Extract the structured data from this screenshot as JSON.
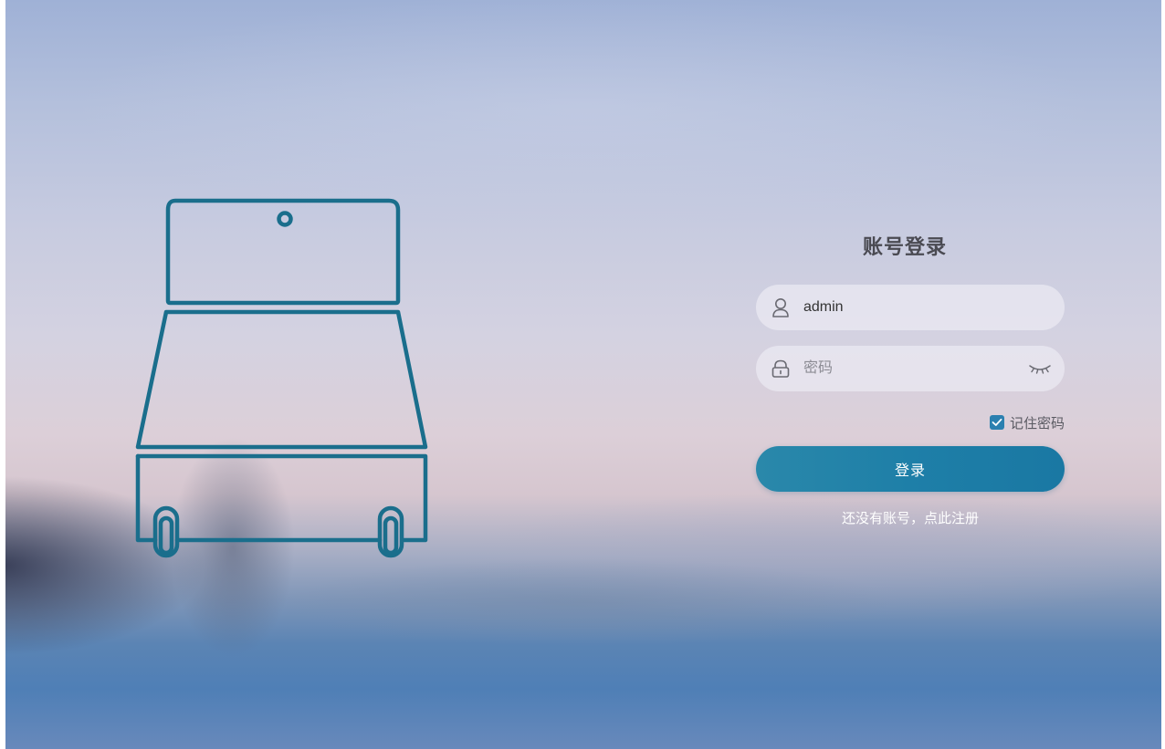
{
  "login": {
    "title": "账号登录",
    "username": {
      "value": "admin",
      "icon": "user-icon"
    },
    "password": {
      "placeholder": "密码",
      "value": "",
      "icon": "lock-icon",
      "toggle_icon": "eye-closed-icon"
    },
    "remember": {
      "label": "记住密码",
      "checked": true
    },
    "submit_label": "登录",
    "register_link": "还没有账号，点此注册"
  },
  "colors": {
    "accent": "#1e7fa8",
    "illustration_stroke": "#1a6e8c",
    "checkbox": "#2b80b0",
    "title_text": "#4a4a52"
  },
  "illustration": {
    "icon": "cart-bed-icon"
  }
}
